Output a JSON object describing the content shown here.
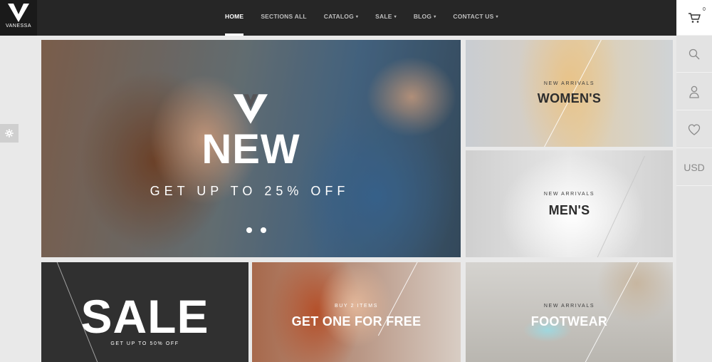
{
  "brand": {
    "name": "VANESSA"
  },
  "nav": {
    "items": [
      {
        "label": "HOME",
        "active": true,
        "dropdown": false
      },
      {
        "label": "SECTIONS ALL",
        "active": false,
        "dropdown": false
      },
      {
        "label": "CATALOG",
        "active": false,
        "dropdown": true
      },
      {
        "label": "SALE",
        "active": false,
        "dropdown": true
      },
      {
        "label": "BLOG",
        "active": false,
        "dropdown": true
      },
      {
        "label": "CONTACT US",
        "active": false,
        "dropdown": true
      }
    ],
    "caret": "▾"
  },
  "rail": {
    "cart_count": "0",
    "currency": "USD",
    "icons": [
      "cart-icon",
      "search-icon",
      "user-icon",
      "heart-icon"
    ]
  },
  "hero": {
    "title": "NEW",
    "subtitle": "GET UP TO 25% OFF",
    "slides": 2
  },
  "tiles": {
    "women": {
      "small": "NEW ARRIVALS",
      "title": "WOMEN'S"
    },
    "men": {
      "small": "NEW ARRIVALS",
      "title": "MEN'S"
    },
    "sale": {
      "title": "SALE",
      "small": "GET UP TO 50% OFF"
    },
    "freebie": {
      "small": "BUY 2 ITEMS",
      "title": "GET ONE FOR FREE"
    },
    "footwear": {
      "small": "NEW ARRIVALS",
      "title": "FOOTWEAR"
    }
  },
  "colors": {
    "topbar": "#262626",
    "rail": "#e3e3e3",
    "accent": "#ffffff"
  }
}
